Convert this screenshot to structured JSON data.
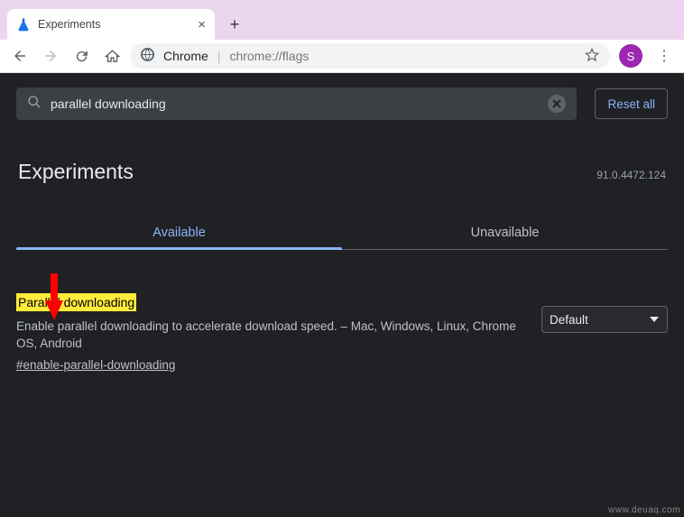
{
  "window": {
    "tab_title": "Experiments"
  },
  "omnibox": {
    "origin_label": "Chrome",
    "url_path": "chrome://flags"
  },
  "profile": {
    "initial": "S"
  },
  "search": {
    "query": "parallel downloading",
    "reset_label": "Reset all"
  },
  "page": {
    "title": "Experiments",
    "version": "91.0.4472.124"
  },
  "tabs": {
    "available": "Available",
    "unavailable": "Unavailable"
  },
  "flag": {
    "title": "Parallel downloading",
    "description": "Enable parallel downloading to accelerate download speed. – Mac, Windows, Linux, Chrome OS, Android",
    "anchor": "#enable-parallel-downloading",
    "selected_option": "Default"
  },
  "watermark": "www.deuaq.com"
}
